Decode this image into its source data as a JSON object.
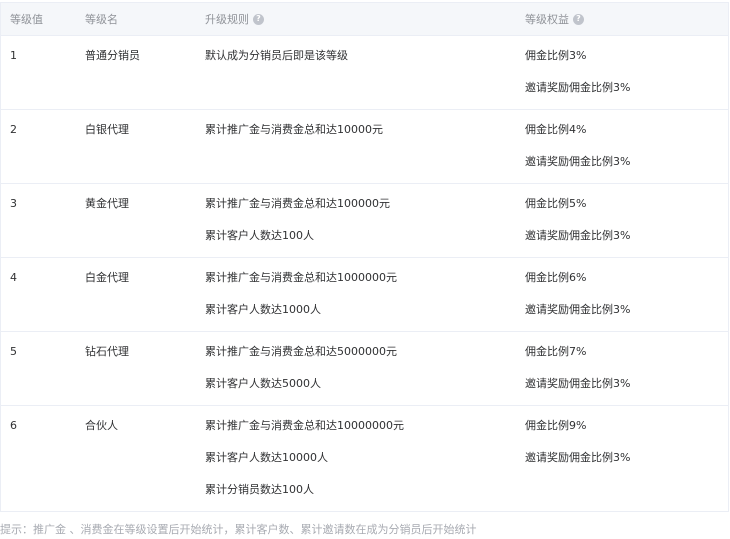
{
  "table": {
    "headers": {
      "level": "等级值",
      "name": "等级名",
      "rule": "升级规则",
      "rights": "等级权益"
    },
    "rows": [
      {
        "level": "1",
        "name": "普通分销员",
        "rules": [
          "默认成为分销员后即是该等级"
        ],
        "rights": [
          "佣金比例3%",
          "邀请奖励佣金比例3%"
        ]
      },
      {
        "level": "2",
        "name": "白银代理",
        "rules": [
          "累计推广金与消费金总和达10000元"
        ],
        "rights": [
          "佣金比例4%",
          "邀请奖励佣金比例3%"
        ]
      },
      {
        "level": "3",
        "name": "黄金代理",
        "rules": [
          "累计推广金与消费金总和达100000元",
          "累计客户人数达100人"
        ],
        "rights": [
          "佣金比例5%",
          "邀请奖励佣金比例3%"
        ]
      },
      {
        "level": "4",
        "name": "白金代理",
        "rules": [
          "累计推广金与消费金总和达1000000元",
          "累计客户人数达1000人"
        ],
        "rights": [
          "佣金比例6%",
          "邀请奖励佣金比例3%"
        ]
      },
      {
        "level": "5",
        "name": "钻石代理",
        "rules": [
          "累计推广金与消费金总和达5000000元",
          "累计客户人数达5000人"
        ],
        "rights": [
          "佣金比例7%",
          "邀请奖励佣金比例3%"
        ]
      },
      {
        "level": "6",
        "name": "合伙人",
        "rules": [
          "累计推广金与消费金总和达10000000元",
          "累计客户人数达10000人",
          "累计分销员数达100人"
        ],
        "rights": [
          "佣金比例9%",
          "邀请奖励佣金比例3%"
        ]
      }
    ]
  },
  "help_icon_glyph": "?",
  "tip": "提示：推广金 、消费金在等级设置后开始统计，累计客户数、累计邀请数在成为分销员后开始统计"
}
